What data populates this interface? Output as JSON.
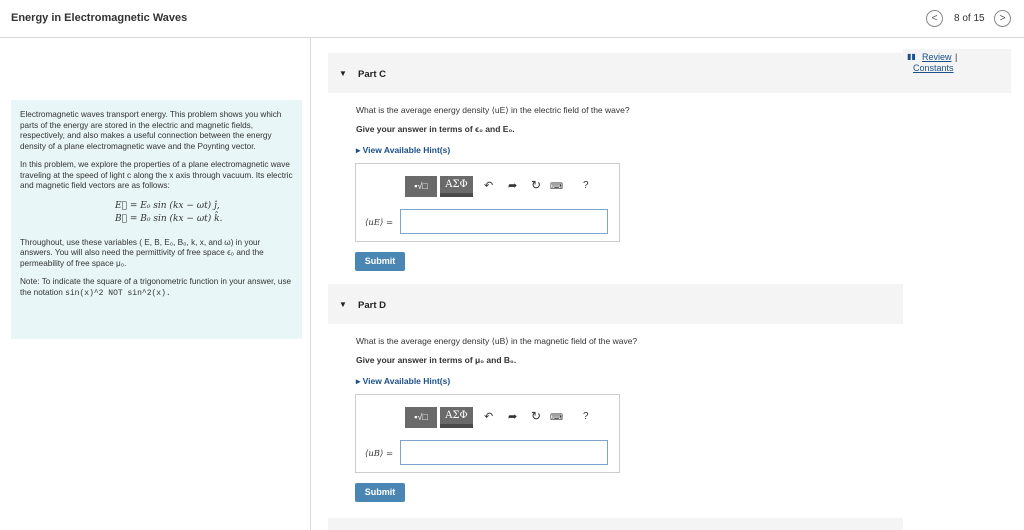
{
  "header": {
    "title": "Energy in Electromagnetic Waves",
    "page_counter": "8 of 15",
    "prev_icon": "chevron-left-icon",
    "next_icon": "chevron-right-icon"
  },
  "intro": {
    "paragraph1": "Electromagnetic waves transport energy. This problem shows you which parts of the energy are stored in the electric and magnetic fields, respectively, and also makes a useful connection between the energy density of a plane electromagnetic wave and the Poynting vector.",
    "paragraph2": "In this problem, we explore the properties of a plane electromagnetic wave traveling at the speed of light c along the x axis through vacuum. Its electric and magnetic field vectors are as follows:",
    "equation_e": "E⃗ = E₀ sin (kx − ωt) ĵ,",
    "equation_b": "B⃗ = B₀ sin (kx − ωt) k̂.",
    "paragraph3": "Throughout, use these variables ( E, B, E₀, B₀, k, x, and ω) in your answers. You will also need the permittivity of free space ϵ₀ and the permeability of free space μ₀.",
    "note_prefix": "Note: To indicate the square of a trigonometric function in your answer, use the notation ",
    "note_code": "sin(x)^2 NOT sin^2(x).",
    "background_color": "#e9f6f7"
  },
  "review": {
    "icon": "book-icon",
    "review_label": "Review",
    "separator": "|",
    "constants_label": "Constants"
  },
  "part_c": {
    "title": "Part C",
    "question": "What is the average energy density ⟨uE⟩ in the electric field of the wave?",
    "instruction": "Give your answer in terms of ϵ₀ and E₀.",
    "hint_label": "View Available Hint(s)",
    "input_label": "⟨uE⟩ =",
    "input_value": "",
    "submit_label": "Submit"
  },
  "part_d": {
    "title": "Part D",
    "question": "What is the average energy density ⟨uB⟩ in the magnetic field of the wave?",
    "instruction": "Give your answer in terms of μ₀ and B₀.",
    "hint_label": "View Available Hint(s)",
    "input_label": "⟨uB⟩ =",
    "input_value": "",
    "submit_label": "Submit"
  },
  "editor_toolbar": {
    "templates_label": "▪√□",
    "greek_label": "ΑΣΦ",
    "undo_icon": "undo-icon",
    "redo_icon": "redo-icon",
    "reset_icon": "reset-icon",
    "keyboard_icon": "keyboard-icon",
    "help_label": "?"
  },
  "colors": {
    "link": "#1a4f8a",
    "submit_bg": "#4a86b4",
    "input_border": "#7ba6c9",
    "toolbar_button": "#6a6a6a"
  }
}
